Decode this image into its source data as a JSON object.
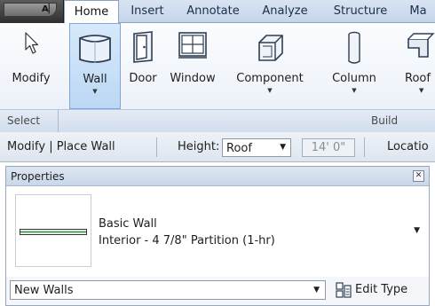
{
  "ribbon": {
    "tabs": [
      {
        "label": "Home"
      },
      {
        "label": "Insert"
      },
      {
        "label": "Annotate"
      },
      {
        "label": "Analyze"
      },
      {
        "label": "Structure"
      },
      {
        "label": "Ma"
      }
    ],
    "tools": {
      "modify": "Modify",
      "wall": "Wall",
      "door": "Door",
      "window": "Window",
      "component": "Component",
      "column": "Column",
      "roof": "Roof"
    },
    "panels": {
      "select": "Select",
      "build": "Build"
    }
  },
  "options_bar": {
    "context": "Modify | Place Wall",
    "height_label": "Height:",
    "height_value": "Roof",
    "offset_value": "14'  0\"",
    "location_label": "Locatio"
  },
  "properties": {
    "title": "Properties",
    "type_family": "Basic Wall",
    "type_name": "Interior - 4 7/8\" Partition (1-hr)",
    "instance_filter": "New Walls",
    "edit_type_label": "Edit Type"
  },
  "colors": {
    "selected_tool_bg": "#bcd8f5",
    "wall_preview_fill": "#49a05a"
  },
  "icons": [
    "app-menu-icon",
    "modify-arrow-icon",
    "wall-icon",
    "door-icon",
    "window-icon",
    "component-icon",
    "column-icon",
    "roof-icon",
    "close-icon",
    "dropdown-arrow-icon",
    "edit-type-icon"
  ]
}
